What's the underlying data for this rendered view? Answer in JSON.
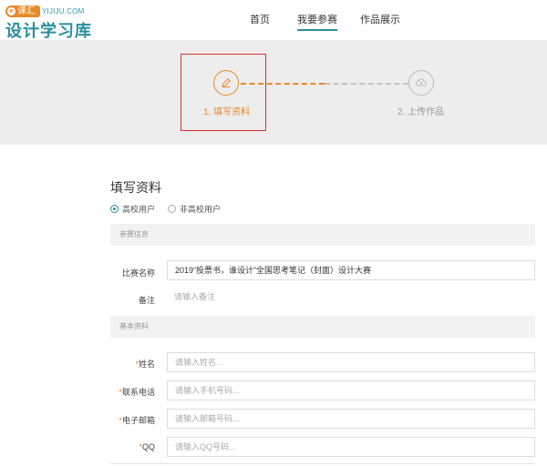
{
  "logo": {
    "badge": "课汇",
    "domain": "YIJIJU.COM",
    "main": "设计学习库"
  },
  "nav": {
    "items": [
      {
        "label": "首页",
        "active": false
      },
      {
        "label": "我要参赛",
        "active": true
      },
      {
        "label": "作品展示",
        "active": false
      }
    ]
  },
  "steps": {
    "step1": {
      "label": "1. 填写资料",
      "icon": "pencil-icon"
    },
    "step2": {
      "label": "2. 上传作品",
      "icon": "cloud-icon"
    }
  },
  "form": {
    "title": "填写资料",
    "radio": {
      "option1": "高校用户",
      "option2": "非高校用户",
      "selected": "高校用户"
    },
    "section_competition": "参赛信息",
    "competition_name_label": "比赛名称",
    "competition_name_value": "2019“投票书，谁设计”全国思考笔记（封面）设计大赛",
    "remark_label": "备注",
    "remark_placeholder": "请输入备注",
    "section_basic": "基本资料",
    "name_label": "姓名",
    "name_placeholder": "请输入姓名...",
    "phone_label": "联系电话",
    "phone_placeholder": "请输入手机号码...",
    "email_label": "电子邮箱",
    "email_placeholder": "请输入邮箱号码...",
    "qq_label": "QQ",
    "qq_placeholder": "请输入QQ号码...",
    "required_mark": "*"
  },
  "colors": {
    "accent": "#e8892b",
    "brand": "#2a8f9d",
    "highlight": "#d9302a"
  }
}
